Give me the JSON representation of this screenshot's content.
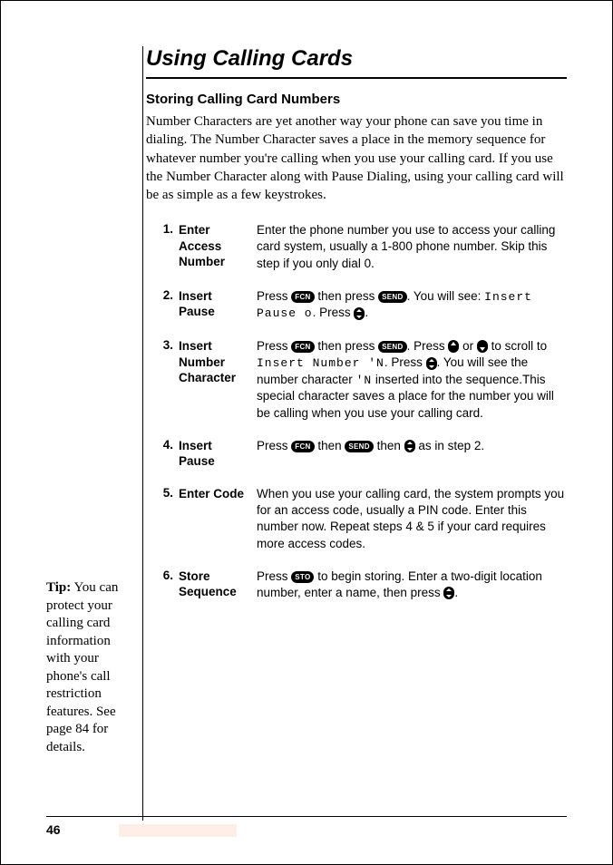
{
  "title": "Using Calling Cards",
  "subheading": "Storing Calling Card Numbers",
  "intro": "Number Characters are yet another way your phone can save you time in dialing. The Number Character saves a place in the memory sequence for whatever number you're calling when you use your calling card. If you use the Number Character along with Pause Dialing, using your calling card will be as simple as a few keystrokes.",
  "buttons": {
    "fcn": "FCN",
    "send": "SEND",
    "sto": "STO"
  },
  "steps": [
    {
      "num": "1.",
      "label": "Enter Access Number",
      "desc": "Enter the phone number you use to access your calling card system, usually a 1-800 phone number. Skip this step if you only dial 0."
    },
    {
      "num": "2.",
      "label": "Insert Pause",
      "d1": "Press ",
      "d2": " then press ",
      "d3": ". You will see: ",
      "lcd": "Insert Pause o",
      "d4": ". Press ",
      "d5": "."
    },
    {
      "num": "3.",
      "label": "Insert Number Character",
      "d1": "Press ",
      "d2": " then press ",
      "d3": ". Press ",
      "d4": " or ",
      "d5": " to scroll to ",
      "lcd": "Insert Number 'N",
      "d6": ". Press ",
      "d7": ". You will see the number character ",
      "lcd2": "'N",
      "d8": " inserted into the sequence.This special character saves a place for the number you will be calling when you use your calling card."
    },
    {
      "num": "4.",
      "label": "Insert Pause",
      "d1": "Press ",
      "d2": " then ",
      "d3": " then ",
      "d4": " as in step 2."
    },
    {
      "num": "5.",
      "label": "Enter Code",
      "desc": "When you use your calling card, the system prompts you for an access code, usually a PIN code. Enter this number now. Repeat steps 4 & 5 if your card requires more access codes."
    },
    {
      "num": "6.",
      "label": "Store Sequence",
      "d1": "Press ",
      "d2": " to begin storing. Enter a two-digit location number, enter a name, then press ",
      "d3": "."
    }
  ],
  "tip": {
    "label": "Tip:",
    "body": "You can protect your calling card information with your phone's call restriction features. See page 84 for details."
  },
  "page_number": "46"
}
